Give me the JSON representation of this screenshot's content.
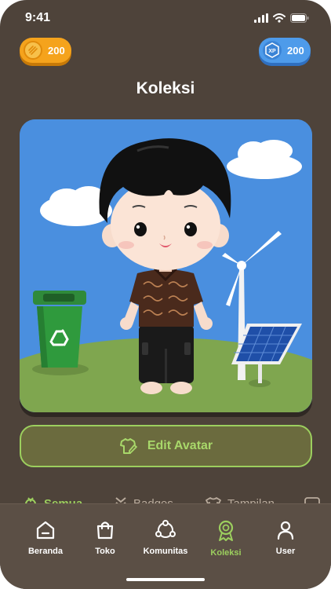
{
  "status": {
    "time": "9:41"
  },
  "currency": {
    "coins": "200",
    "xp": "200",
    "xp_badge": "XP"
  },
  "page_title": "Koleksi",
  "edit_button_label": "Edit Avatar",
  "tabs": [
    {
      "label": "Semua",
      "icon": "medal-icon"
    },
    {
      "label": "Badges",
      "icon": "chevron-rank-icon"
    },
    {
      "label": "Tampilan",
      "icon": "shirt-icon"
    },
    {
      "label": "",
      "icon": "frame-icon"
    }
  ],
  "nav": [
    {
      "label": "Beranda",
      "icon": "home-icon"
    },
    {
      "label": "Toko",
      "icon": "shopping-bag-icon"
    },
    {
      "label": "Komunitas",
      "icon": "community-icon"
    },
    {
      "label": "Koleksi",
      "icon": "award-ribbon-icon",
      "active": true
    },
    {
      "label": "User",
      "icon": "user-icon"
    }
  ],
  "colors": {
    "background": "#4e433a",
    "accent_green": "#9ccf5e",
    "coin_orange": "#f5a31c",
    "xp_blue": "#4e9bea",
    "sky": "#4a8fdf",
    "grass": "#7fa64f"
  }
}
